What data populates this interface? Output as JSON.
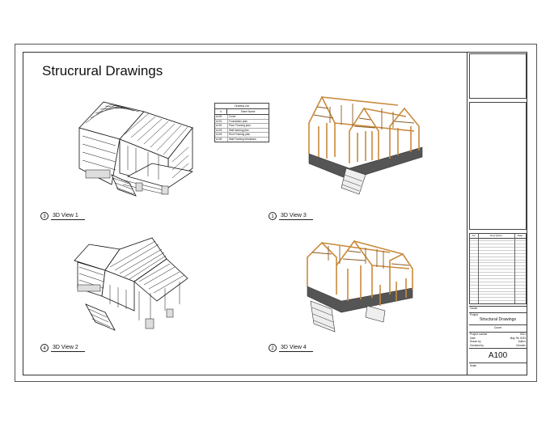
{
  "page_title": "Strucrural Drawings",
  "views": [
    {
      "number": "3",
      "label": "3D View  1"
    },
    {
      "number": "1",
      "label": "3D View 3"
    },
    {
      "number": "4",
      "label": "3D View 2"
    },
    {
      "number": "2",
      "label": "3D View 4"
    }
  ],
  "drawing_list": {
    "title": "Drawing List",
    "col_number": "#",
    "col_name": "Sheet Name",
    "rows": [
      {
        "num": "A100",
        "name": "Cover"
      },
      {
        "num": "A101",
        "name": "Foundation plan"
      },
      {
        "num": "A102",
        "name": "Floor Framing plan"
      },
      {
        "num": "A103",
        "name": "Wall framing plan"
      },
      {
        "num": "A104",
        "name": "Roof Framing plan"
      },
      {
        "num": "A105",
        "name": "Wall Framing elevations"
      }
    ]
  },
  "title_block": {
    "rev_headers": [
      "No.",
      "Description",
      "Date"
    ],
    "owner_label": "Owner",
    "project_label": "Project",
    "sheet_name": "Structural Drawings",
    "sheet_sub": "Cover",
    "project_number_label": "Project number",
    "project_number": "0001",
    "date_label": "Date",
    "date": "May 7th 2023",
    "drawn_by_label": "Drawn by",
    "drawn_by": "Author",
    "checked_by_label": "Checked by",
    "checked_by": "Checker",
    "sheet_number": "A100",
    "scale_label": "Scale"
  },
  "colors": {
    "wood": "#c98a3c",
    "wood_dark": "#8a5a22",
    "foundation": "#555555",
    "line": "#111111"
  }
}
